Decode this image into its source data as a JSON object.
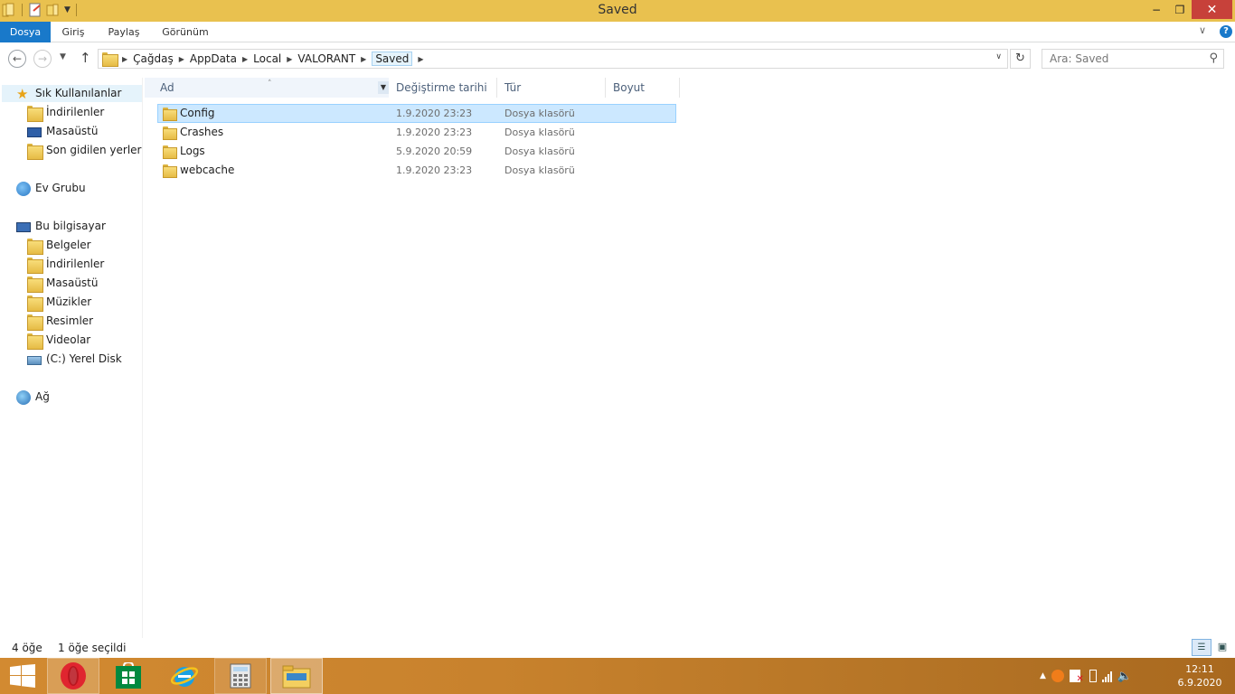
{
  "window": {
    "title": "Saved"
  },
  "titlebar": {
    "minimize": "−",
    "maximize": "❐",
    "close": "✕"
  },
  "ribbon": {
    "tabs": [
      "Dosya",
      "Giriş",
      "Paylaş",
      "Görünüm"
    ],
    "expand": "∨",
    "help": "?"
  },
  "nav": {
    "back": "←",
    "forward": "→",
    "recent": "▼",
    "up": "↑",
    "breadcrumbs": [
      "Çağdaş",
      "AppData",
      "Local",
      "VALORANT",
      "Saved"
    ],
    "refresh": "↻",
    "search_placeholder": "Ara: Saved",
    "dropdown": "∨"
  },
  "sidebar": {
    "favorites_header": "Sık Kullanılanlar",
    "favorites": [
      "İndirilenler",
      "Masaüstü",
      "Son gidilen yerler"
    ],
    "homegroup": "Ev Grubu",
    "computer_header": "Bu bilgisayar",
    "computer": [
      "Belgeler",
      "İndirilenler",
      "Masaüstü",
      "Müzikler",
      "Resimler",
      "Videolar",
      "(C:) Yerel Disk"
    ],
    "network": "Ağ"
  },
  "list": {
    "columns": {
      "name": "Ad",
      "date": "Değiştirme tarihi",
      "type": "Tür",
      "size": "Boyut"
    },
    "sort_arrow": "˄",
    "rows": [
      {
        "name": "Config",
        "date": "1.9.2020 23:23",
        "type": "Dosya klasörü",
        "selected": true
      },
      {
        "name": "Crashes",
        "date": "1.9.2020 23:23",
        "type": "Dosya klasörü",
        "selected": false
      },
      {
        "name": "Logs",
        "date": "5.9.2020 20:59",
        "type": "Dosya klasörü",
        "selected": false
      },
      {
        "name": "webcache",
        "date": "1.9.2020 23:23",
        "type": "Dosya klasörü",
        "selected": false
      }
    ]
  },
  "status": {
    "count": "4 öğe",
    "selected": "1 öğe seçildi"
  },
  "clock": {
    "time": "12:11",
    "date": "6.9.2020"
  },
  "colors": {
    "titlebar": "#e9c14f",
    "accent": "#1979ca",
    "taskbar": "#c8822d",
    "selection": "#cce8ff"
  }
}
